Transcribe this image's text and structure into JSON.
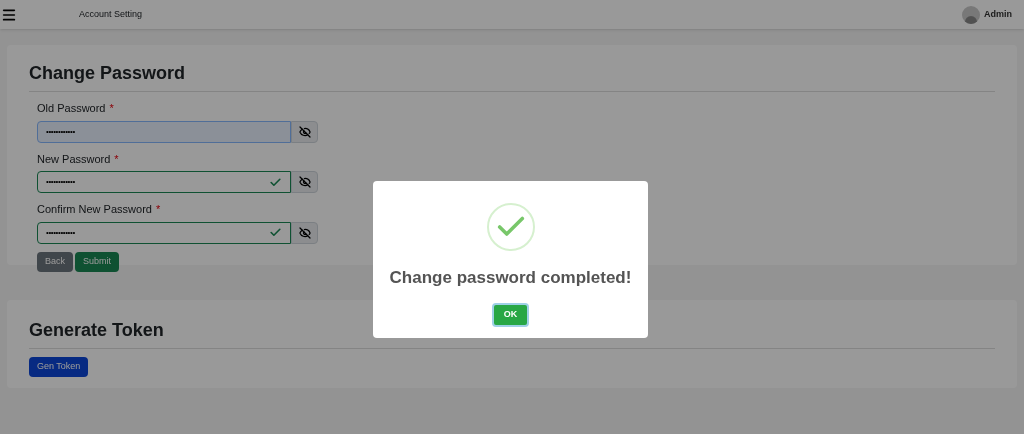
{
  "header": {
    "title": "Account Setting",
    "user": "Admin"
  },
  "change_password": {
    "title": "Change Password",
    "fields": [
      {
        "label": "Old Password",
        "required_mark": "*",
        "value": "••••••••••••",
        "valid": false,
        "autofilled": true
      },
      {
        "label": "New Password",
        "required_mark": "*",
        "value": "••••••••••••",
        "valid": true,
        "autofilled": false
      },
      {
        "label": "Confirm New Password",
        "required_mark": "*",
        "value": "••••••••••••",
        "valid": true,
        "autofilled": false
      }
    ],
    "buttons": [
      {
        "label": "Back",
        "kind": "secondary"
      },
      {
        "label": "Submit",
        "kind": "success"
      }
    ]
  },
  "generate_token": {
    "title": "Generate Token",
    "button": "Gen Token"
  },
  "dialog": {
    "message": "Change password completed!",
    "button": "OK"
  }
}
